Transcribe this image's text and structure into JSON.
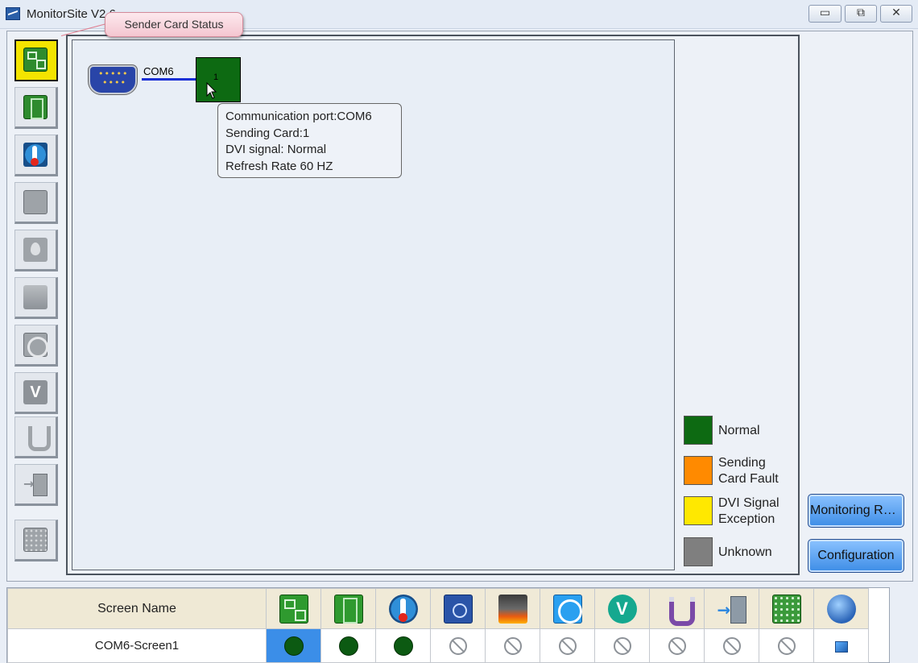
{
  "window": {
    "title": "MonitorSite V2.6",
    "controls": {
      "minimize": "▭",
      "maximize": "⧉",
      "close": "✕"
    }
  },
  "callout": {
    "text": "Sender Card Status"
  },
  "toolbar": {
    "items": [
      {
        "name": "sender-card-status",
        "icon": "sender-card-icon",
        "active": true
      },
      {
        "name": "receiving-card-status",
        "icon": "receiving-card-icon",
        "active": false
      },
      {
        "name": "temperature",
        "icon": "thermometer-icon",
        "active": false
      },
      {
        "name": "module-fan",
        "icon": "module-icon",
        "active": false
      },
      {
        "name": "humidity",
        "icon": "water-drop-icon",
        "active": false
      },
      {
        "name": "smoke",
        "icon": "smoke-icon",
        "active": false
      },
      {
        "name": "fan",
        "icon": "fan-icon",
        "active": false
      },
      {
        "name": "voltage",
        "icon": "voltage-icon",
        "active": false
      },
      {
        "name": "cable",
        "icon": "magnet-icon",
        "active": false
      },
      {
        "name": "door",
        "icon": "door-icon",
        "active": false
      },
      {
        "name": "module",
        "icon": "led-panel-icon",
        "active": false
      }
    ]
  },
  "topology": {
    "port_label": "COM6",
    "card_number": "1",
    "tooltip": [
      "Communication port:COM6",
      "Sending Card:1",
      "DVI signal: Normal",
      "Refresh Rate 60 HZ"
    ]
  },
  "legend": [
    {
      "label_line1": "Normal",
      "label_line2": "",
      "color": "#0d6a12"
    },
    {
      "label_line1": "Sending",
      "label_line2": "Card Fault",
      "color": "#ff8a00"
    },
    {
      "label_line1": "DVI Signal",
      "label_line2": "Exception",
      "color": "#ffe800"
    },
    {
      "label_line1": "Unknown",
      "label_line2": "",
      "color": "#7f7f7f"
    }
  ],
  "buttons": {
    "monitoring_refresh": "Monitoring Ref...",
    "configuration": "Configuration"
  },
  "status_table": {
    "header_name": "Screen Name",
    "columns": [
      "sender-card-icon",
      "receiving-card-icon",
      "thermometer-icon",
      "module-fan-icon",
      "smoke-icon",
      "fan-icon",
      "voltage-icon",
      "magnet-icon",
      "door-icon",
      "led-panel-icon",
      "globe-icon"
    ],
    "rows": [
      {
        "name": "COM6-Screen1",
        "cells": [
          "ok",
          "ok",
          "ok",
          "na",
          "na",
          "na",
          "na",
          "na",
          "na",
          "na",
          "img"
        ]
      }
    ]
  }
}
